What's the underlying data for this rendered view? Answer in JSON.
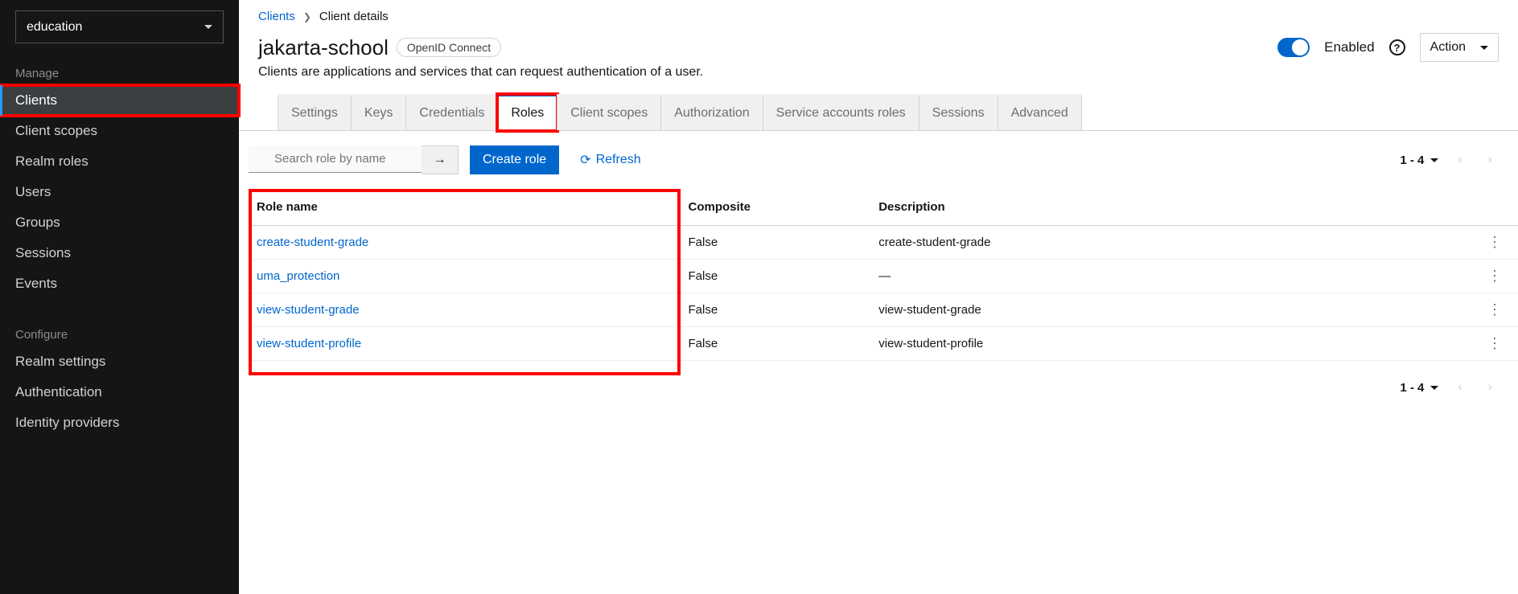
{
  "realm_selector": {
    "selected": "education"
  },
  "sidebar": {
    "manage_header": "Manage",
    "configure_header": "Configure",
    "manage_items": [
      {
        "label": "Clients",
        "active": true,
        "highlight": true
      },
      {
        "label": "Client scopes"
      },
      {
        "label": "Realm roles"
      },
      {
        "label": "Users"
      },
      {
        "label": "Groups"
      },
      {
        "label": "Sessions"
      },
      {
        "label": "Events"
      }
    ],
    "configure_items": [
      {
        "label": "Realm settings"
      },
      {
        "label": "Authentication"
      },
      {
        "label": "Identity providers"
      }
    ]
  },
  "breadcrumb": {
    "root": "Clients",
    "current": "Client details"
  },
  "header": {
    "title": "jakarta-school",
    "badge": "OpenID Connect",
    "subtitle": "Clients are applications and services that can request authentication of a user.",
    "enabled_label": "Enabled",
    "action_label": "Action"
  },
  "tabs": [
    {
      "label": "Settings"
    },
    {
      "label": "Keys"
    },
    {
      "label": "Credentials"
    },
    {
      "label": "Roles",
      "active": true,
      "highlight": true
    },
    {
      "label": "Client scopes"
    },
    {
      "label": "Authorization"
    },
    {
      "label": "Service accounts roles"
    },
    {
      "label": "Sessions"
    },
    {
      "label": "Advanced"
    }
  ],
  "toolbar": {
    "search_placeholder": "Search role by name",
    "create_label": "Create role",
    "refresh_label": "Refresh",
    "pagination_text": "1 - 4"
  },
  "table": {
    "headers": {
      "name": "Role name",
      "composite": "Composite",
      "description": "Description"
    },
    "rows": [
      {
        "name": "create-student-grade",
        "composite": "False",
        "description": "create-student-grade"
      },
      {
        "name": "uma_protection",
        "composite": "False",
        "description": "—"
      },
      {
        "name": "view-student-grade",
        "composite": "False",
        "description": "view-student-grade"
      },
      {
        "name": "view-student-profile",
        "composite": "False",
        "description": "view-student-profile"
      }
    ],
    "highlight_names": true
  }
}
